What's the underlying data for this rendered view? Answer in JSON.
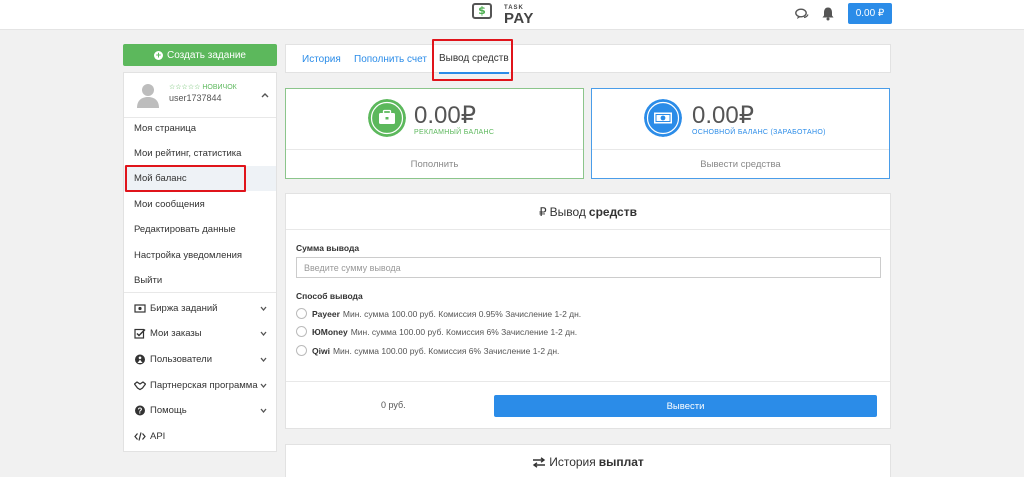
{
  "header": {
    "logo_top": "TASK",
    "logo_bottom": "PAY",
    "logo_symbol": "$",
    "balance_button": "0.00 ₽"
  },
  "sidebar": {
    "create_button": "Создать задание",
    "profile": {
      "rank": "☆☆☆☆☆ НОВИЧОК",
      "username": "user1737844"
    },
    "menu": [
      {
        "label": "Моя страница"
      },
      {
        "label": "Мои рейтинг, статистика"
      },
      {
        "label": "Мой баланс"
      },
      {
        "label": "Мои сообщения"
      },
      {
        "label": "Редактировать данные"
      },
      {
        "label": "Настройка уведомления"
      },
      {
        "label": "Выйти"
      }
    ],
    "sections": [
      {
        "label": "Биржа заданий",
        "icon": "exchange-icon"
      },
      {
        "label": "Мои заказы",
        "icon": "checkbox-icon"
      },
      {
        "label": "Пользователи",
        "icon": "user-circle-icon"
      },
      {
        "label": "Партнерская программа",
        "icon": "handshake-icon"
      },
      {
        "label": "Помощь",
        "icon": "question-icon"
      },
      {
        "label": "API",
        "icon": "code-icon"
      }
    ]
  },
  "tabs": [
    {
      "label": "История"
    },
    {
      "label": "Пополнить счет"
    },
    {
      "label": "Вывод средств"
    }
  ],
  "balances": {
    "ad": {
      "amount": "0.00₽",
      "label": "РЕКЛАМНЫЙ БАЛАНС",
      "action": "Пополнить",
      "color": "#5cb85c"
    },
    "main": {
      "amount": "0.00₽",
      "label": "ОСНОВНОЙ БАЛАНС (ЗАРАБОТАНО)",
      "action": "Вывести средства",
      "color": "#2b8ce8"
    }
  },
  "withdraw": {
    "title_symbol": "₽",
    "title_prefix": "Вывод",
    "title_bold": "средств",
    "amount_label": "Сумма вывода",
    "amount_placeholder": "Введите сумму вывода",
    "method_label": "Способ вывода",
    "methods": [
      {
        "name": "Payeer",
        "details": "Мин. сумма 100.00 руб. Комиссия 0.95% Зачисление 1-2 дн."
      },
      {
        "name": "ЮMoney",
        "details": "Мин. сумма 100.00 руб. Комиссия 6% Зачисление 1-2 дн."
      },
      {
        "name": "Qiwi",
        "details": "Мин. сумма 100.00 руб. Комиссия 6% Зачисление 1-2 дн."
      }
    ],
    "sum": "0 руб.",
    "submit": "Вывести"
  },
  "history": {
    "title_prefix": "История",
    "title_bold": "выплат"
  }
}
